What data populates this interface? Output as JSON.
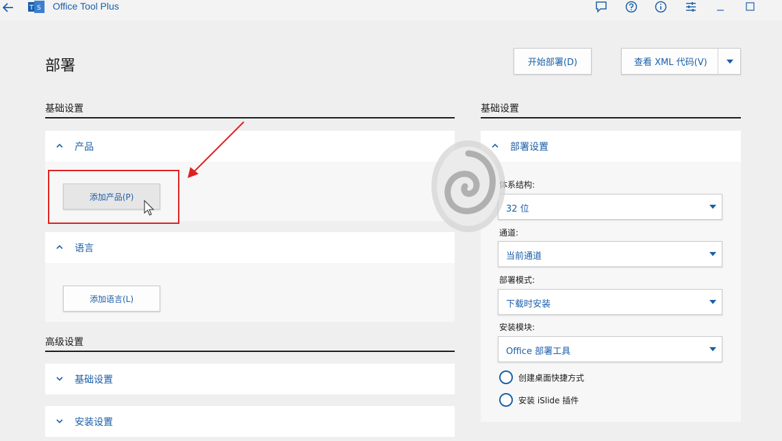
{
  "window": {
    "title": "Office Tool Plus"
  },
  "page": {
    "title": "部署"
  },
  "toolbar": {
    "start_deploy": "开始部署(D)",
    "view_xml": "查看 XML 代码(V)"
  },
  "left": {
    "basic_header": "基础设置",
    "product": {
      "label": "产品",
      "button": "添加产品(P)"
    },
    "language": {
      "label": "语言",
      "button": "添加语言(L)"
    },
    "advanced_header": "高级设置",
    "advanced_items": [
      {
        "label": "基础设置"
      },
      {
        "label": "安装设置"
      }
    ]
  },
  "right": {
    "header": "基础设置",
    "deploy_settings": "部署设置",
    "fields": [
      {
        "label": "体系结构:",
        "value": "32 位"
      },
      {
        "label": "通道:",
        "value": "当前通道"
      },
      {
        "label": "部署模式:",
        "value": "下载时安装"
      },
      {
        "label": "安装模块:",
        "value": "Office 部署工具"
      }
    ],
    "options": [
      {
        "label": "创建桌面快捷方式"
      },
      {
        "label": "安装 iSlide 插件"
      }
    ]
  },
  "colors": {
    "accent": "#1a5ea8",
    "highlight": "#e02020",
    "background": "#efefef"
  },
  "icons": {
    "titlebar": [
      "back-arrow-icon",
      "app-logo-icon",
      "feedback-icon",
      "help-icon",
      "info-icon",
      "settings-sliders-icon",
      "minimize-icon",
      "maximize-icon"
    ]
  }
}
